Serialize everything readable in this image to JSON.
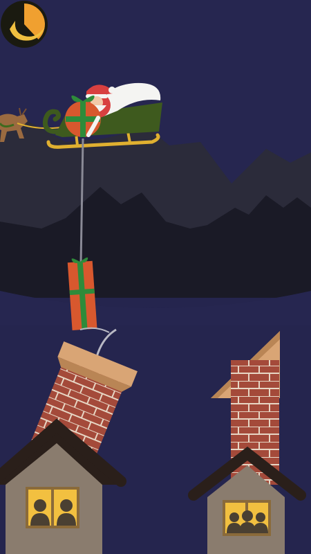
{
  "game": {
    "theme": "christmas-night-delivery",
    "timer": {
      "icon": "moon-timer-icon",
      "remaining_fraction": 0.38,
      "color": "#F0A030"
    },
    "rope": {
      "icon": "rope-icon"
    },
    "present": {
      "icon": "gift-box-icon",
      "box_color": "#D8582E",
      "ribbon_color": "#2E8B3A"
    },
    "sleigh": {
      "icon": "santa-sleigh-icon",
      "color": "#3E5A1E",
      "runner_color": "#E0B030"
    },
    "houses": [
      {
        "name": "left-house",
        "window_silhouettes": 2
      },
      {
        "name": "right-house",
        "window_silhouettes": 3
      }
    ]
  },
  "colors": {
    "sky": "#262650",
    "far_mountains": "#2C2C3C",
    "near_mountains": "#1A1A26",
    "roof": "#2A1F1A",
    "wall": "#8A7C6E",
    "window": "#F2C040",
    "brick": "#A44A3A",
    "chimney_top": "#D9A575"
  }
}
